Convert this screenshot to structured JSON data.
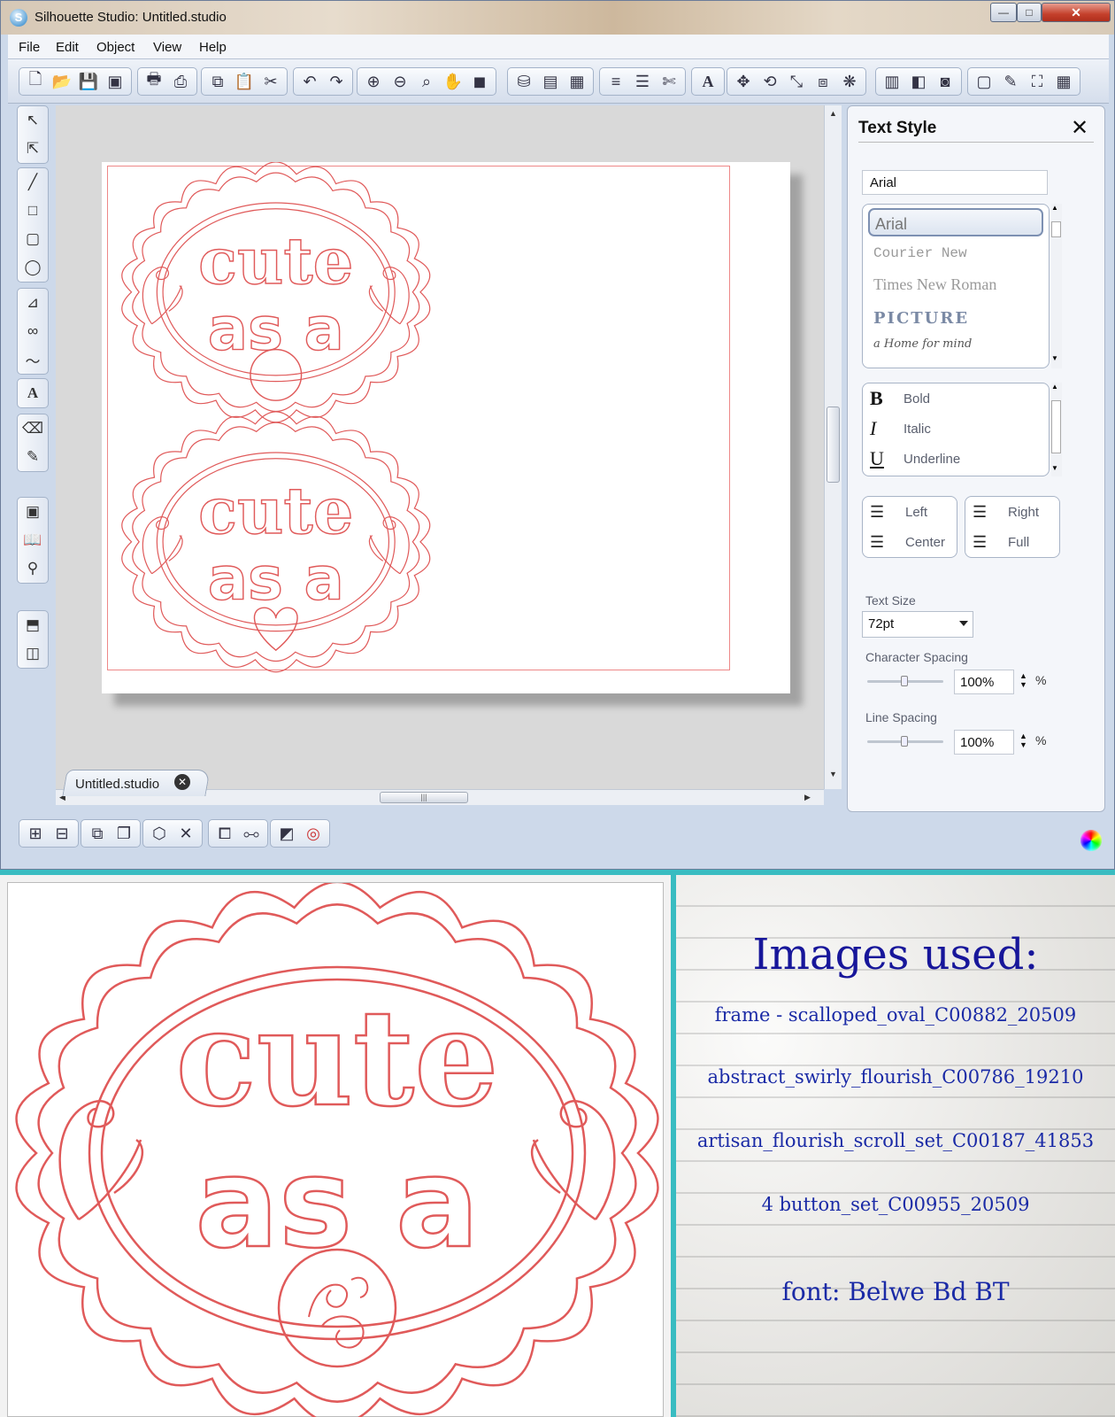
{
  "window": {
    "title": "Silhouette Studio: Untitled.studio",
    "controls": {
      "minimize": "—",
      "maximize": "□",
      "close": "✕"
    }
  },
  "menu": [
    "File",
    "Edit",
    "Object",
    "View",
    "Help"
  ],
  "document_tab": {
    "label": "Untitled.studio"
  },
  "text_style": {
    "title": "Text Style",
    "font_input_value": "Arial",
    "fonts": [
      "Arial",
      "Courier New",
      "Times New Roman",
      "PICTURE",
      "a Home for mind"
    ],
    "selected_font": "Arial",
    "format": [
      {
        "glyph": "B",
        "label": "Bold"
      },
      {
        "glyph": "I",
        "label": "Italic"
      },
      {
        "glyph": "U",
        "label": "Underline"
      }
    ],
    "align": {
      "left": "Left",
      "center": "Center",
      "right": "Right",
      "full": "Full"
    },
    "text_size_label": "Text Size",
    "text_size_value": "72pt",
    "char_spacing_label": "Character Spacing",
    "char_spacing_value": "100%",
    "line_spacing_label": "Line Spacing",
    "line_spacing_value": "100%",
    "percent": "%"
  },
  "design": {
    "line1": "cute",
    "line2": "as a",
    "stroke_color": "#e05a5a"
  },
  "notes": {
    "title": "Images used:",
    "credits": [
      "frame - scalloped_oval_C00882_20509",
      "abstract_swirly_flourish_C00786_19210",
      "artisan_flourish_scroll_set_C00187_41853",
      "4 button_set_C00955_20509",
      "font: Belwe Bd BT"
    ],
    "ink_color": "#17169a"
  }
}
